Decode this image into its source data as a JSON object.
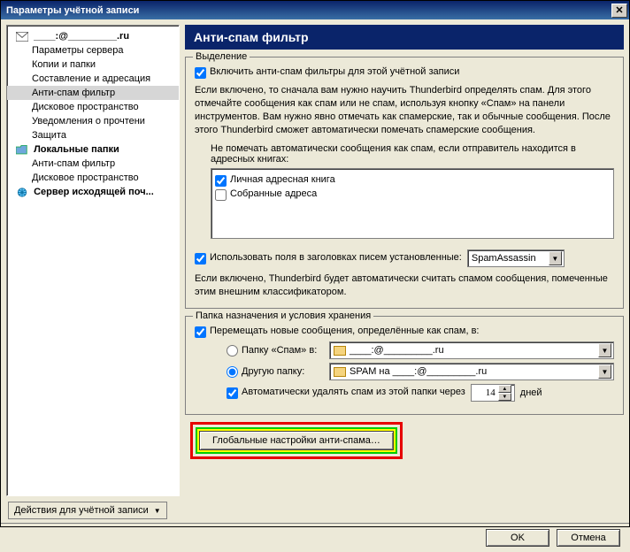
{
  "window": {
    "title": "Параметры учётной записи"
  },
  "sidebar": {
    "account": "____:@_________.ru",
    "items": [
      "Параметры сервера",
      "Копии и папки",
      "Составление и адресация",
      "Анти-спам фильтр",
      "Дисковое пространство",
      "Уведомления о прочтени",
      "Защита"
    ],
    "local": "Локальные папки",
    "local_items": [
      "Анти-спам фильтр",
      "Дисковое пространство"
    ],
    "smtp": "Сервер исходящей поч..."
  },
  "panel": {
    "title": "Анти-спам фильтр",
    "highlight": {
      "legend": "Выделение",
      "enable": "Включить анти-спам фильтры для этой учётной записи",
      "desc": "Если включено, то сначала вам нужно научить Thunderbird определять спам. Для этого отмечайте сообщения как спам или не спам, используя кнопку «Спам» на панели инструментов. Вам нужно явно отмечать как спамерские, так и обычные сообщения. После этого Thunderbird сможет автоматически помечать спамерские сообщения.",
      "skip": "Не помечать автоматически сообщения как спам, если отправитель находится в адресных книгах:",
      "books": [
        "Личная адресная книга",
        "Собранные адреса"
      ],
      "use_headers": "Использовать поля в заголовках писем установленные:",
      "classifier": "SpamAssassin",
      "hdesc": "Если включено, Thunderbird будет автоматически считать спамом сообщения, помеченные этим внешним классификатором."
    },
    "dest": {
      "legend": "Папка назначения и условия хранения",
      "move": "Перемещать новые сообщения, определённые как спам, в:",
      "spam_folder": "Папку «Спам» в:",
      "spam_sel": "____:@_________.ru",
      "other_folder": "Другую папку:",
      "other_sel": "SPAM на ____:@_________.ru",
      "autodel": "Автоматически удалять спам из этой папки через",
      "days": "14",
      "days_label": "дней"
    },
    "global_btn": "Глобальные настройки анти-спама…"
  },
  "bottom": {
    "actions": "Действия для учётной записи"
  },
  "buttons": {
    "ok": "OK",
    "cancel": "Отмена"
  }
}
